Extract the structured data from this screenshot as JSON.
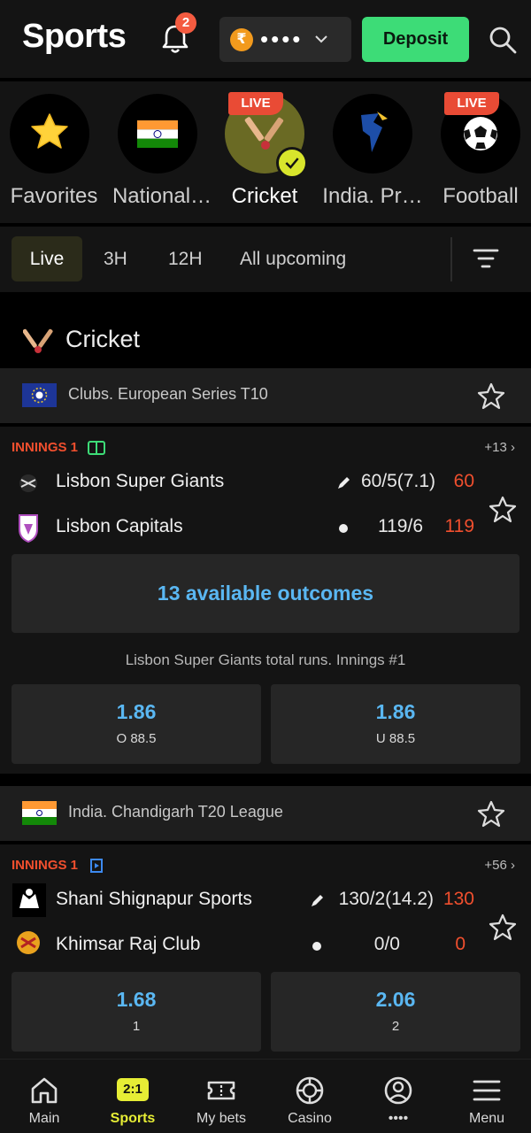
{
  "header": {
    "title": "Sports",
    "notifications_count": "2",
    "currency_symbol": "₹",
    "balance_masked": "••••",
    "deposit_label": "Deposit"
  },
  "sports": [
    {
      "label": "Favorites",
      "icon": "star-icon",
      "live": false,
      "active": false
    },
    {
      "label": "National…",
      "icon": "india-flag-icon",
      "live": false,
      "active": false
    },
    {
      "label": "Cricket",
      "icon": "cricket-icon",
      "live": true,
      "active": true
    },
    {
      "label": "India. Pr…",
      "icon": "ipl-icon",
      "live": false,
      "active": false
    },
    {
      "label": "Football",
      "icon": "football-icon",
      "live": true,
      "active": false
    }
  ],
  "live_tag": "LIVE",
  "filters": [
    {
      "label": "Live",
      "active": true
    },
    {
      "label": "3H",
      "active": false
    },
    {
      "label": "12H",
      "active": false
    },
    {
      "label": "All upcoming",
      "active": false
    }
  ],
  "section_title": "Cricket",
  "events": [
    {
      "league": "Clubs. European Series T10",
      "innings": "INNINGS 1",
      "more": "+13",
      "team1": {
        "name": "Lisbon Super Giants",
        "score": "60/5(7.1)",
        "total": "60"
      },
      "team2": {
        "name": "Lisbon Capitals",
        "score": "119/6",
        "total": "119"
      },
      "outcomes_label": "13 available outcomes",
      "market": "Lisbon Super Giants total runs. Innings #1",
      "odds": [
        {
          "value": "1.86",
          "label": "O 88.5"
        },
        {
          "value": "1.86",
          "label": "U 88.5"
        }
      ]
    },
    {
      "league": "India. Chandigarh T20 League",
      "innings": "INNINGS 1",
      "more": "+56",
      "team1": {
        "name": "Shani Shignapur Sports",
        "score": "130/2(14.2)",
        "total": "130"
      },
      "team2": {
        "name": "Khimsar Raj Club",
        "score": "0/0",
        "total": "0"
      },
      "odds": [
        {
          "value": "1.68",
          "label": "1"
        },
        {
          "value": "2.06",
          "label": "2"
        }
      ]
    }
  ],
  "bottom_nav": [
    {
      "label": "Main",
      "icon": "home-icon",
      "active": false
    },
    {
      "label": "Sports",
      "icon": "sports-badge-icon",
      "badge": "2:1",
      "active": true
    },
    {
      "label": "My bets",
      "icon": "ticket-icon",
      "active": false
    },
    {
      "label": "Casino",
      "icon": "casino-chip-icon",
      "active": false
    },
    {
      "label": "••••",
      "icon": "profile-icon",
      "active": false
    },
    {
      "label": "Menu",
      "icon": "menu-icon",
      "active": false
    }
  ],
  "colors": {
    "accent_yellow": "#e6ed35",
    "deposit_green": "#3ddc77",
    "live_red": "#e94b35",
    "odds_blue": "#5ab7f2",
    "score_orange": "#f04f2e"
  }
}
